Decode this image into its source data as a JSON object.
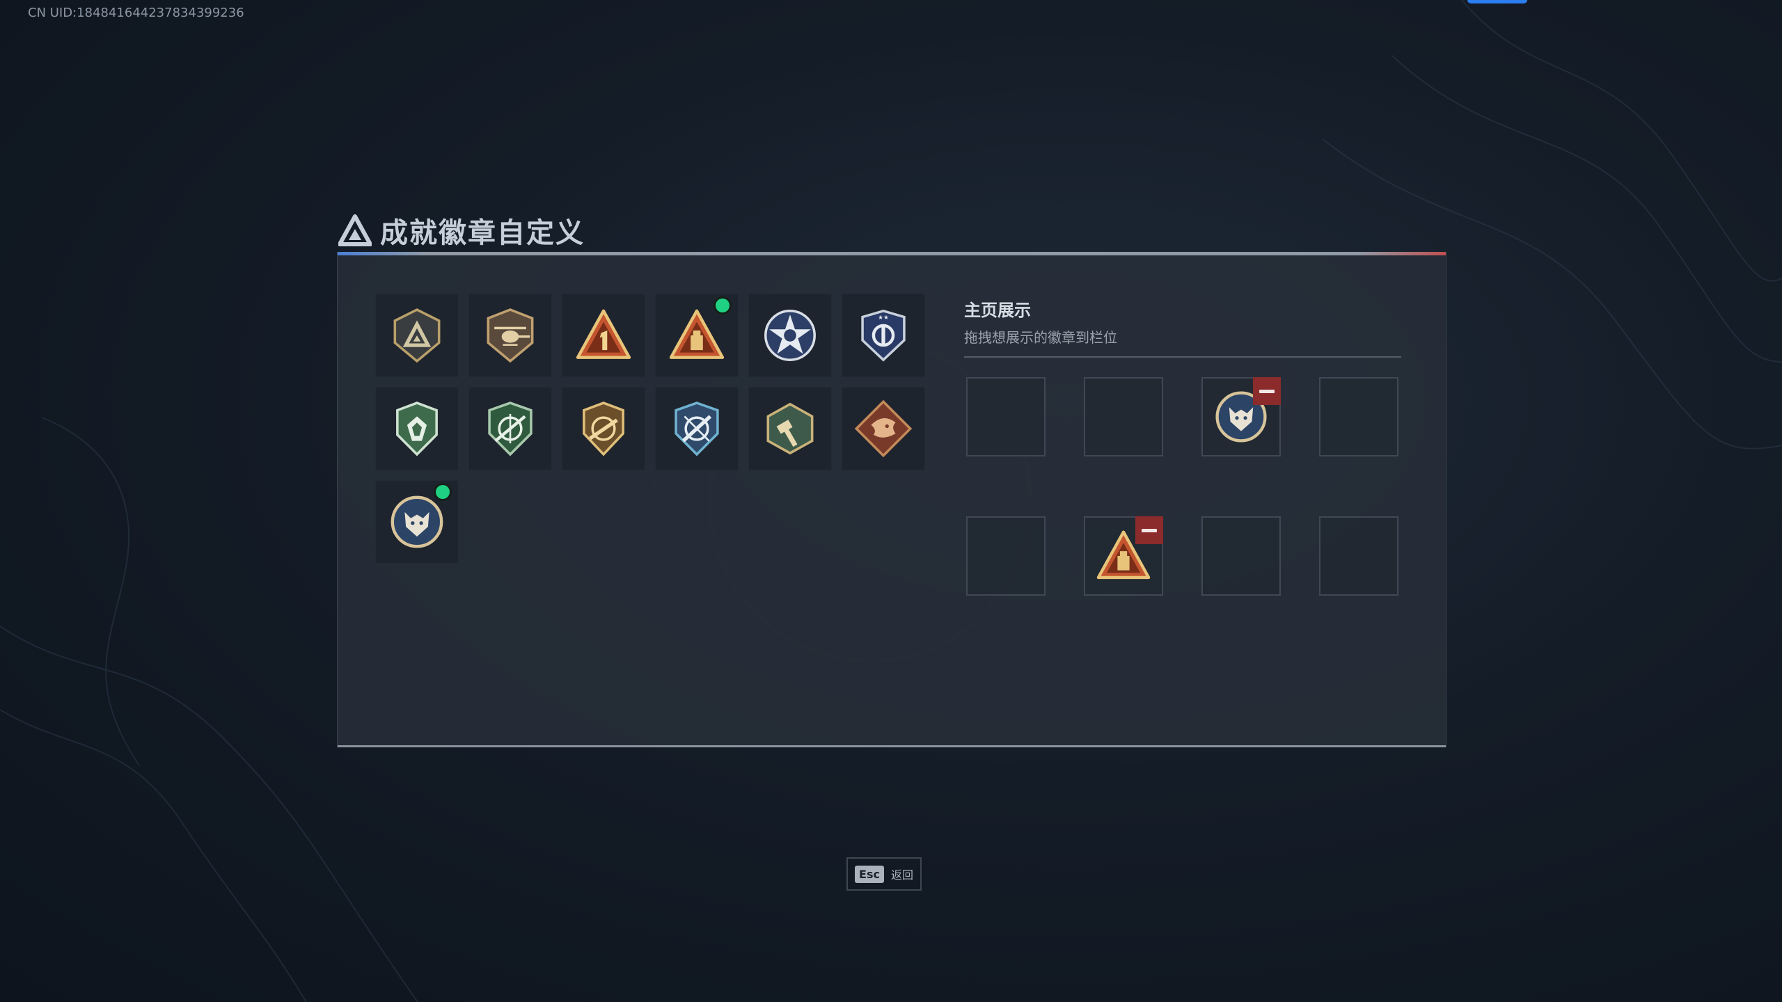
{
  "uid_text": "CN UID:1848416442378343992​36",
  "header": {
    "title": "成就徽章自定义",
    "icon": "delta-triangle-icon"
  },
  "badges": [
    {
      "icon": "shield-delta-icon",
      "new": false
    },
    {
      "icon": "shield-helicopter-icon",
      "new": false
    },
    {
      "icon": "triangle-number-one-icon",
      "new": false
    },
    {
      "icon": "triangle-tower-icon",
      "new": true
    },
    {
      "icon": "star-circle-icon",
      "new": false
    },
    {
      "icon": "blue-shield-icon",
      "new": false
    },
    {
      "icon": "green-shield-icon",
      "new": false
    },
    {
      "icon": "green-crosshair-shield-icon",
      "new": false
    },
    {
      "icon": "gold-rifle-shield-icon",
      "new": false
    },
    {
      "icon": "blue-wrench-shield-icon",
      "new": false
    },
    {
      "icon": "hexagon-hammer-icon",
      "new": false
    },
    {
      "icon": "dragon-diamond-icon",
      "new": false
    },
    {
      "icon": "wolf-circle-icon",
      "new": true
    }
  ],
  "showcase": {
    "title": "主页展示",
    "subtitle": "拖拽想展示的徽章到栏位",
    "slots": [
      "",
      "",
      "wolf-circle-icon",
      "",
      "",
      "triangle-tower-icon",
      "",
      ""
    ]
  },
  "footer": {
    "esc_key": "Esc",
    "esc_label": "返回"
  },
  "colors": {
    "accent": "#2c7df0",
    "new_dot": "#1fd283",
    "remove": "#8c2b2b"
  }
}
